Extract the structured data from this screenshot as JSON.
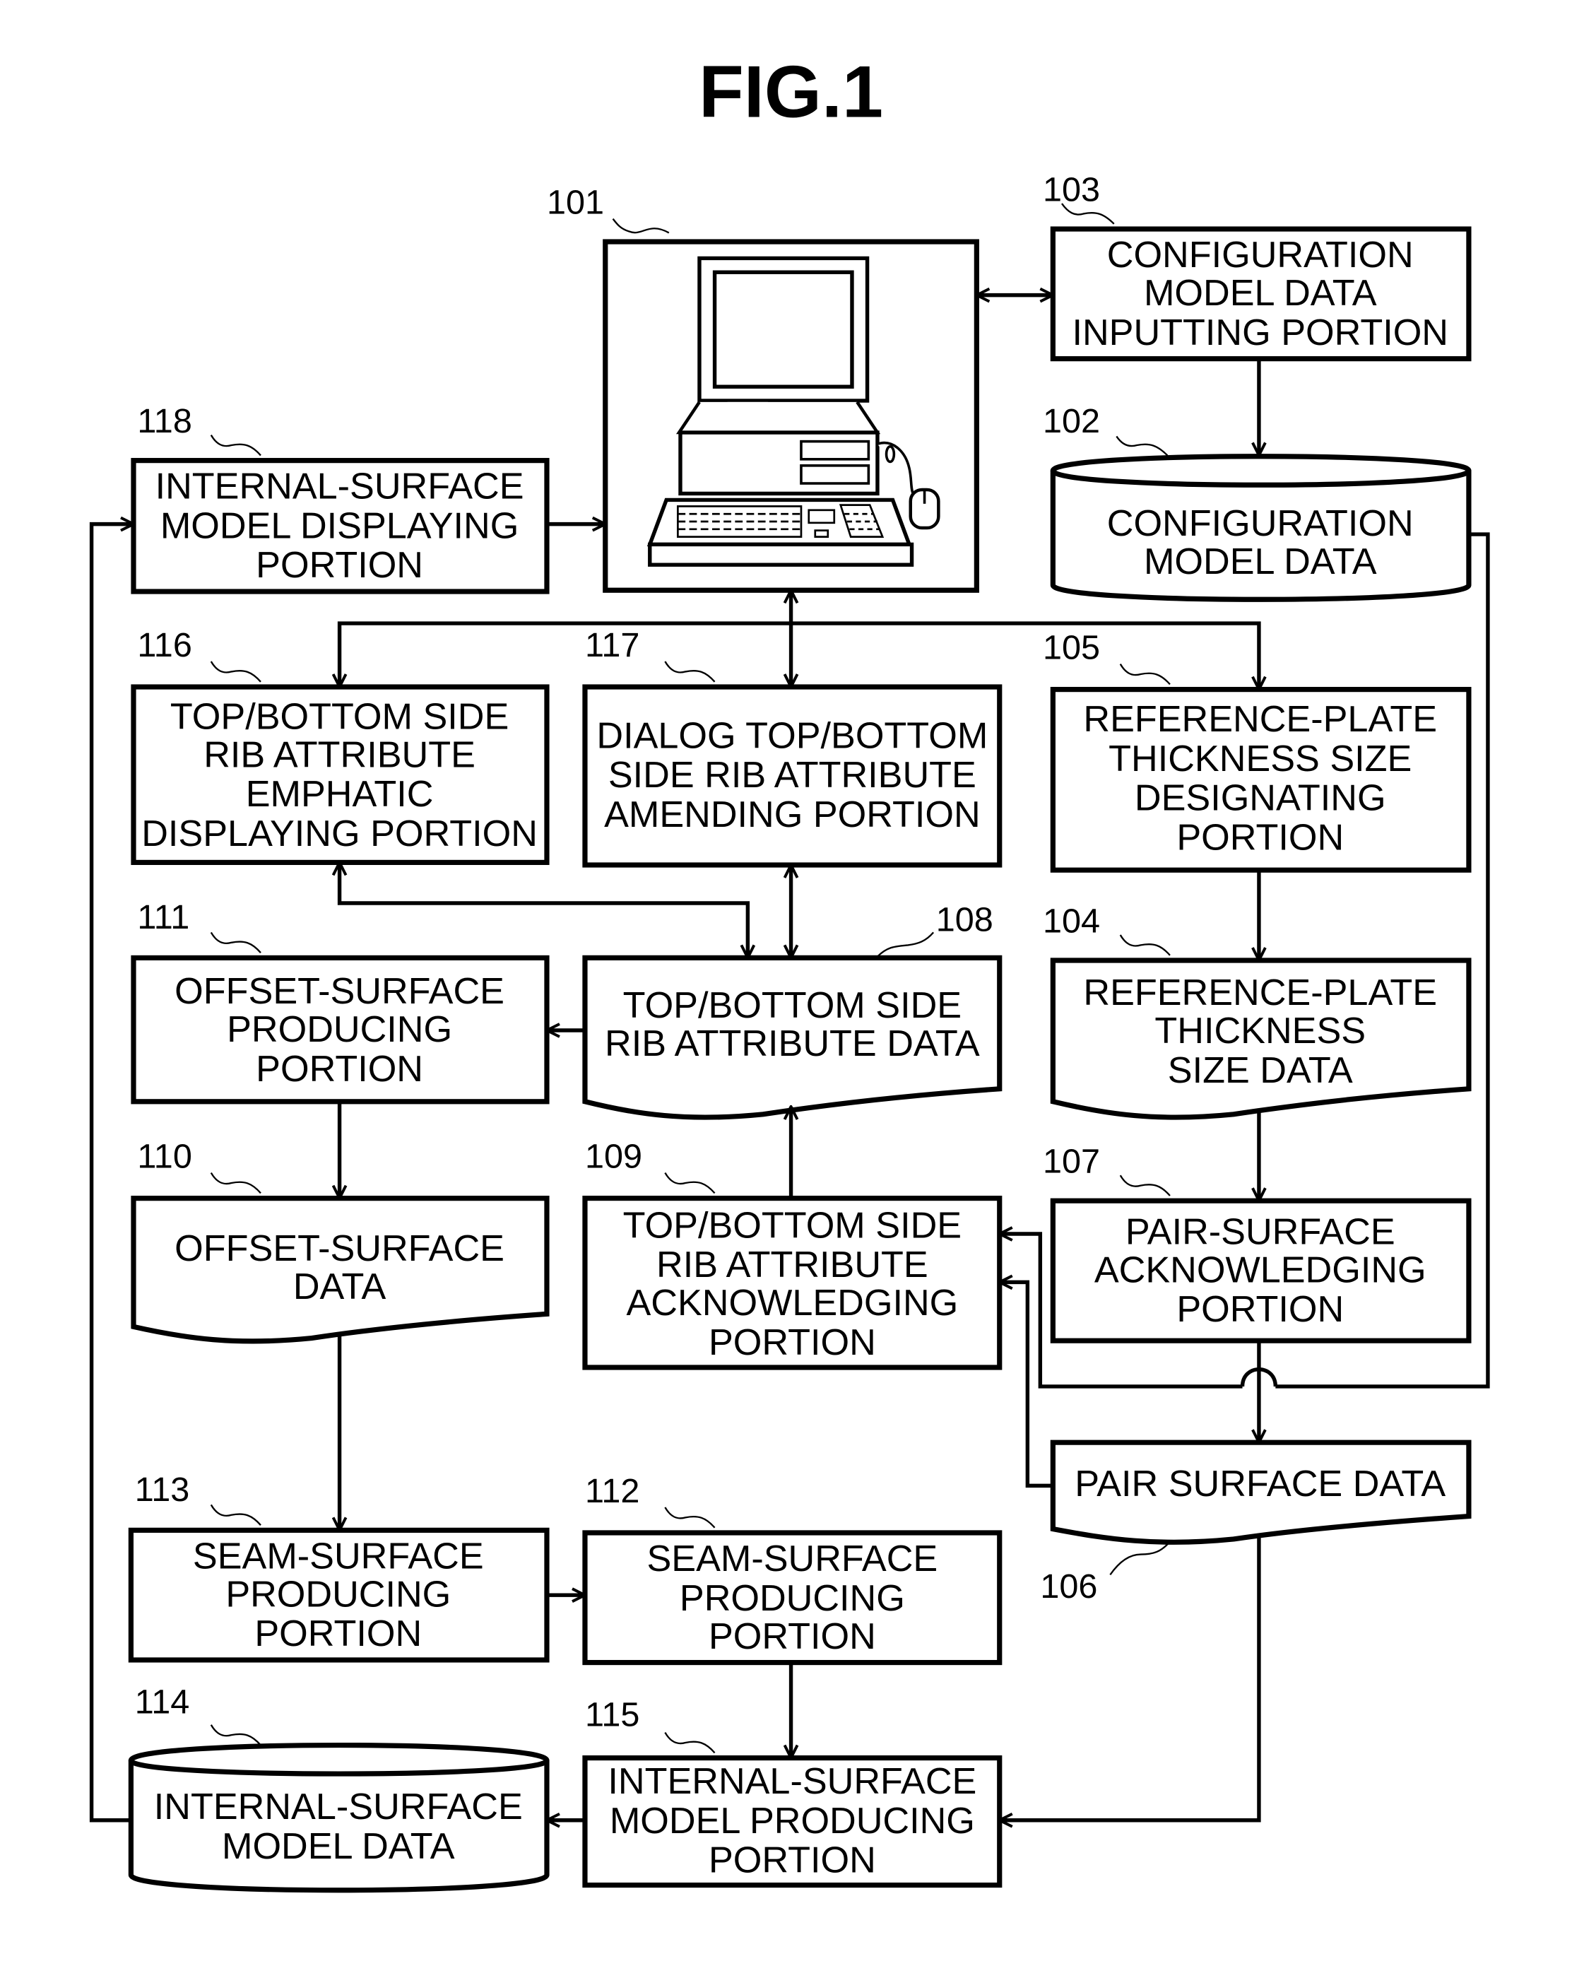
{
  "figure": {
    "title": "FIG.1"
  },
  "nodes": {
    "n101": {
      "ref": "101",
      "lines": [],
      "icon": "computer-terminal-icon"
    },
    "n103": {
      "ref": "103",
      "lines": [
        "CONFIGURATION",
        "MODEL DATA",
        "INPUTTING PORTION"
      ]
    },
    "n102": {
      "ref": "102",
      "lines": [
        "CONFIGURATION",
        "MODEL DATA"
      ]
    },
    "n118": {
      "ref": "118",
      "lines": [
        "INTERNAL-SURFACE",
        "MODEL DISPLAYING",
        "PORTION"
      ]
    },
    "n116": {
      "ref": "116",
      "lines": [
        "TOP/BOTTOM SIDE",
        "RIB ATTRIBUTE",
        "EMPHATIC",
        "DISPLAYING PORTION"
      ]
    },
    "n117": {
      "ref": "117",
      "lines": [
        "DIALOG TOP/BOTTOM",
        "SIDE RIB ATTRIBUTE",
        "AMENDING PORTION"
      ]
    },
    "n105": {
      "ref": "105",
      "lines": [
        "REFERENCE-PLATE",
        "THICKNESS SIZE",
        "DESIGNATING",
        "PORTION"
      ]
    },
    "n111": {
      "ref": "111",
      "lines": [
        "OFFSET-SURFACE",
        "PRODUCING",
        "PORTION"
      ]
    },
    "n108": {
      "ref": "108",
      "lines": [
        "TOP/BOTTOM SIDE",
        "RIB ATTRIBUTE DATA"
      ]
    },
    "n104": {
      "ref": "104",
      "lines": [
        "REFERENCE-PLATE",
        "THICKNESS",
        "SIZE DATA"
      ]
    },
    "n110": {
      "ref": "110",
      "lines": [
        "OFFSET-SURFACE",
        "DATA"
      ]
    },
    "n109": {
      "ref": "109",
      "lines": [
        "TOP/BOTTOM SIDE",
        "RIB ATTRIBUTE",
        "ACKNOWLEDGING",
        "PORTION"
      ]
    },
    "n107": {
      "ref": "107",
      "lines": [
        "PAIR-SURFACE",
        "ACKNOWLEDGING",
        "PORTION"
      ]
    },
    "n106": {
      "ref": "106",
      "lines": [
        "PAIR SURFACE DATA"
      ]
    },
    "n113": {
      "ref": "113",
      "lines": [
        "SEAM-SURFACE",
        "PRODUCING",
        "PORTION"
      ]
    },
    "n112": {
      "ref": "112",
      "lines": [
        "SEAM-SURFACE",
        "PRODUCING",
        "PORTION"
      ]
    },
    "n114": {
      "ref": "114",
      "lines": [
        "INTERNAL-SURFACE",
        "MODEL DATA"
      ]
    },
    "n115": {
      "ref": "115",
      "lines": [
        "INTERNAL-SURFACE",
        "MODEL PRODUCING",
        "PORTION"
      ]
    }
  },
  "edges": [
    {
      "from": "101",
      "to": "103",
      "type": "bidirectional"
    },
    {
      "from": "103",
      "to": "102",
      "type": "arrow"
    },
    {
      "from": "118",
      "to": "101",
      "type": "arrow"
    },
    {
      "from": "101",
      "to": "116",
      "type": "arrow"
    },
    {
      "from": "101",
      "to": "117",
      "type": "bidirectional"
    },
    {
      "from": "101",
      "to": "105",
      "type": "arrow"
    },
    {
      "from": "105",
      "to": "104",
      "type": "arrow"
    },
    {
      "from": "104",
      "to": "107",
      "type": "arrow"
    },
    {
      "from": "102",
      "to": "107",
      "type": "arrow"
    },
    {
      "from": "107",
      "to": "106",
      "type": "arrow"
    },
    {
      "from": "102",
      "to": "109",
      "type": "arrow"
    },
    {
      "from": "106",
      "to": "109",
      "type": "arrow"
    },
    {
      "from": "109",
      "to": "108",
      "type": "arrow"
    },
    {
      "from": "117",
      "to": "108",
      "type": "bidirectional"
    },
    {
      "from": "108",
      "to": "116",
      "type": "bidirectional"
    },
    {
      "from": "108",
      "to": "111",
      "type": "arrow"
    },
    {
      "from": "111",
      "to": "110",
      "type": "arrow"
    },
    {
      "from": "110",
      "to": "113",
      "type": "arrow"
    },
    {
      "from": "113",
      "to": "112",
      "type": "arrow"
    },
    {
      "from": "112",
      "to": "115",
      "type": "arrow"
    },
    {
      "from": "106",
      "to": "115",
      "type": "arrow"
    },
    {
      "from": "115",
      "to": "114",
      "type": "arrow"
    },
    {
      "from": "114",
      "to": "118",
      "type": "arrow"
    }
  ]
}
